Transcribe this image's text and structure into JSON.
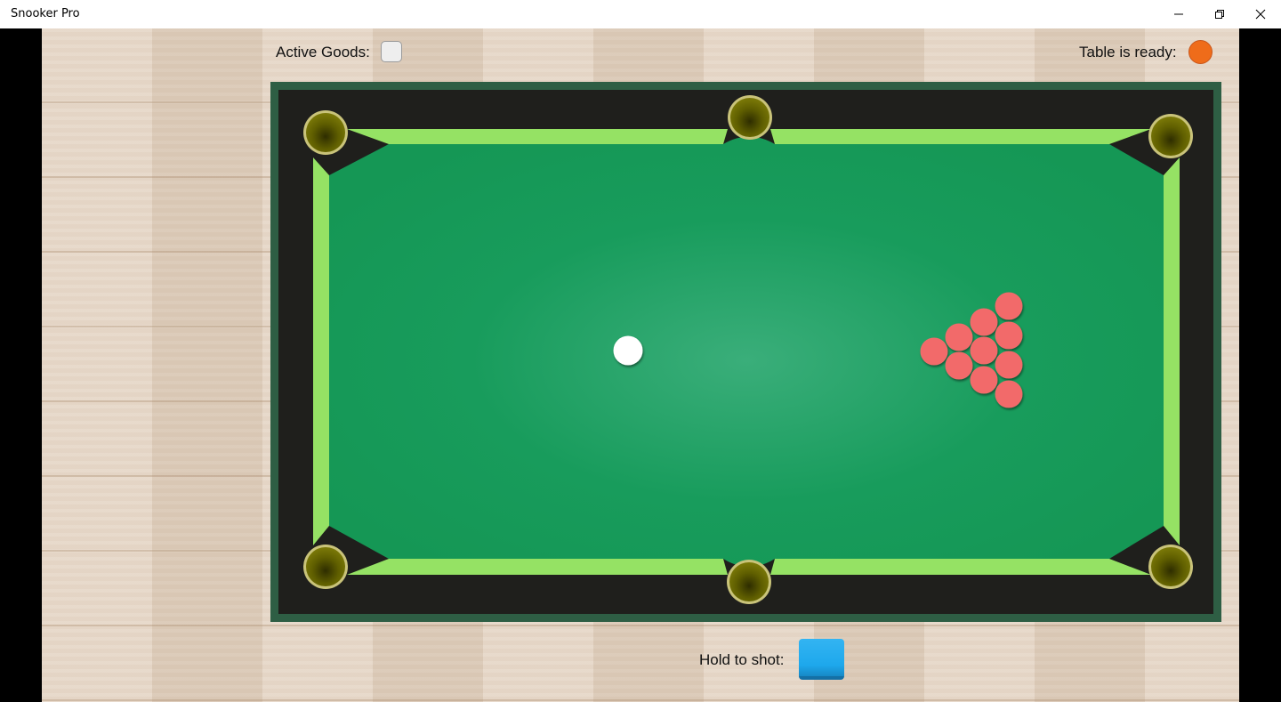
{
  "window": {
    "title": "Snooker Pro"
  },
  "hud": {
    "active_goods_label": "Active Goods:",
    "table_ready_label": "Table is ready:",
    "hold_to_shot_label": "Hold to shot:"
  },
  "colors": {
    "felt": "#169a5a",
    "cushion": "#95e264",
    "rail": "#1f1f1c",
    "frame": "#2e5e44",
    "pocket": "#6b6a00",
    "pocket_rim": "#c9c37a",
    "cue_ball": "#ffffff",
    "red_ball": "#f26b6b",
    "ready_indicator": "#ef6c1a",
    "shot_button": "#1ea8ec"
  },
  "game": {
    "cue_ball_count": 1,
    "red_ball_count": 10,
    "pocket_count": 6,
    "table_ready": true,
    "active_goods_checked": false
  }
}
